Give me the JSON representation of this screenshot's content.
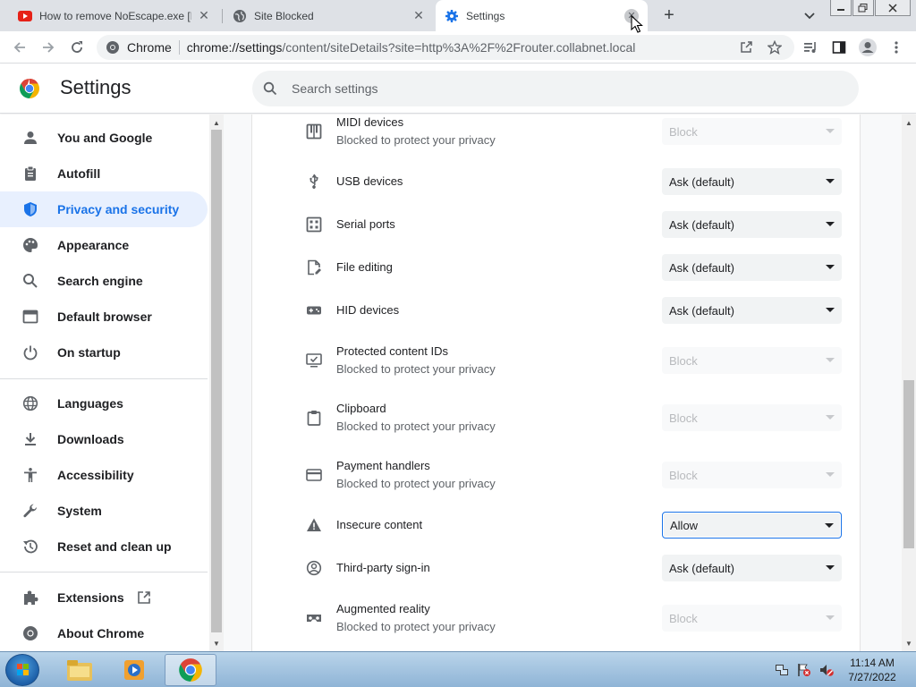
{
  "browser": {
    "tabs": [
      {
        "title": "How to remove NoEscape.exe [D",
        "close": "✕"
      },
      {
        "title": "Site Blocked",
        "close": "✕"
      },
      {
        "title": "Settings",
        "close": "✕"
      }
    ],
    "new_tab": "+",
    "omnibox": {
      "site": "Chrome",
      "url_host": "chrome://settings",
      "url_path": "/content/siteDetails?site=http%3A%2F%2Frouter.collabnet.local"
    }
  },
  "header": {
    "title": "Settings",
    "search_placeholder": "Search settings"
  },
  "sidebar": {
    "items": [
      {
        "label": "You and Google",
        "icon": "person-icon"
      },
      {
        "label": "Autofill",
        "icon": "clipboard-icon"
      },
      {
        "label": "Privacy and security",
        "icon": "shield-icon",
        "active": true
      },
      {
        "label": "Appearance",
        "icon": "palette-icon"
      },
      {
        "label": "Search engine",
        "icon": "search-icon"
      },
      {
        "label": "Default browser",
        "icon": "browser-icon"
      },
      {
        "label": "On startup",
        "icon": "power-icon"
      },
      {
        "label": "Languages",
        "icon": "globe-icon"
      },
      {
        "label": "Downloads",
        "icon": "download-icon"
      },
      {
        "label": "Accessibility",
        "icon": "accessibility-icon"
      },
      {
        "label": "System",
        "icon": "wrench-icon"
      },
      {
        "label": "Reset and clean up",
        "icon": "history-icon"
      },
      {
        "label": "Extensions",
        "icon": "puzzle-icon"
      },
      {
        "label": "About Chrome",
        "icon": "chrome-icon"
      }
    ]
  },
  "permissions": [
    {
      "label": "MIDI devices",
      "sub": "Blocked to protect your privacy",
      "value": "Block",
      "disabled": true,
      "icon": "piano-icon"
    },
    {
      "label": "USB devices",
      "sub": "",
      "value": "Ask (default)",
      "disabled": false,
      "icon": "usb-icon"
    },
    {
      "label": "Serial ports",
      "sub": "",
      "value": "Ask (default)",
      "disabled": false,
      "icon": "serial-port-icon"
    },
    {
      "label": "File editing",
      "sub": "",
      "value": "Ask (default)",
      "disabled": false,
      "icon": "file-edit-icon"
    },
    {
      "label": "HID devices",
      "sub": "",
      "value": "Ask (default)",
      "disabled": false,
      "icon": "gamepad-icon"
    },
    {
      "label": "Protected content IDs",
      "sub": "Blocked to protect your privacy",
      "value": "Block",
      "disabled": true,
      "icon": "monitor-check-icon"
    },
    {
      "label": "Clipboard",
      "sub": "Blocked to protect your privacy",
      "value": "Block",
      "disabled": true,
      "icon": "clipboard-icon"
    },
    {
      "label": "Payment handlers",
      "sub": "Blocked to protect your privacy",
      "value": "Block",
      "disabled": true,
      "icon": "credit-card-icon"
    },
    {
      "label": "Insecure content",
      "sub": "",
      "value": "Allow",
      "disabled": false,
      "focused": true,
      "icon": "warning-icon"
    },
    {
      "label": "Third-party sign-in",
      "sub": "",
      "value": "Ask (default)",
      "disabled": false,
      "icon": "account-circle-icon"
    },
    {
      "label": "Augmented reality",
      "sub": "Blocked to protect your privacy",
      "value": "Block",
      "disabled": true,
      "icon": "vr-headset-icon"
    }
  ],
  "taskbar": {
    "time": "11:14 AM",
    "date": "7/27/2022"
  },
  "colors": {
    "accent": "#1a73e8",
    "active_nav_bg": "#e8f0fe",
    "tabstrip": "#dee1e6"
  }
}
